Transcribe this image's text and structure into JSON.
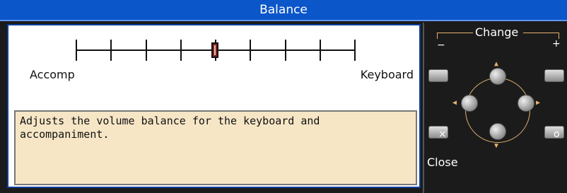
{
  "window": {
    "title": "Balance"
  },
  "slider": {
    "left_label": "Accomp",
    "right_label": "Keyboard",
    "tick_count": 9,
    "value_fraction": 0.5
  },
  "description": "Adjusts the volume balance for the keyboard and\naccompaniment.",
  "controls": {
    "change_label": "Change",
    "minus_symbol": "−",
    "plus_symbol": "+",
    "x_symbol": "×",
    "o_symbol": "o",
    "close_label": "Close",
    "arrow_up": "▲",
    "arrow_down": "▼",
    "arrow_left": "◀",
    "arrow_right": "▶",
    "accent_color": "#e6b16f"
  },
  "colors": {
    "title_bar": "#0b56c9",
    "description_bg": "#f6e6c6",
    "knob": "#8a1f1f"
  }
}
